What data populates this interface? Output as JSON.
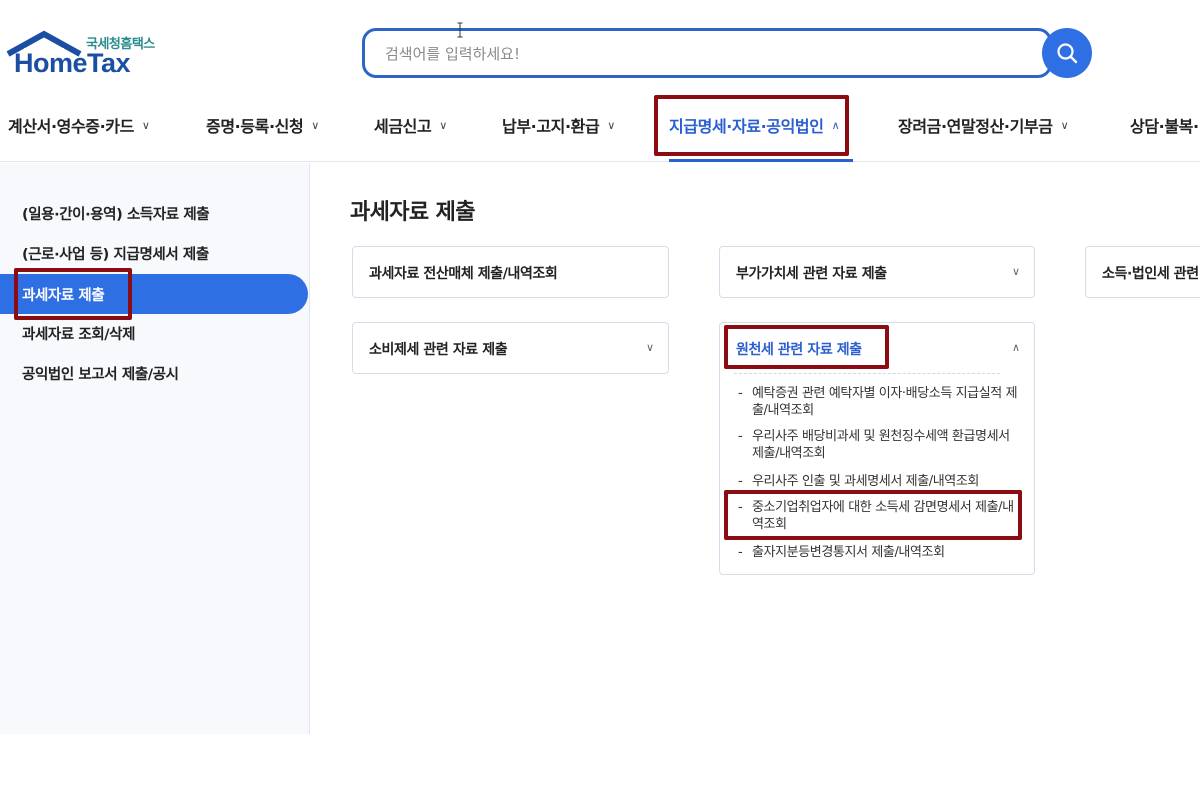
{
  "header": {
    "logo_sub": "국세청홈택스",
    "logo_main": "HomeTax",
    "search_placeholder": "검색어를 입력하세요!"
  },
  "nav": {
    "items": [
      {
        "label": "계산서·영수증·카드"
      },
      {
        "label": "증명·등록·신청"
      },
      {
        "label": "세금신고"
      },
      {
        "label": "납부·고지·환급"
      },
      {
        "label": "지급명세·자료·공익법인",
        "active": true
      },
      {
        "label": "장려금·연말정산·기부금"
      },
      {
        "label": "상담·불복·"
      }
    ]
  },
  "sidebar": {
    "items": [
      {
        "label": "(일용·간이·용역) 소득자료 제출"
      },
      {
        "label": "(근로·사업 등) 지급명세서 제출"
      },
      {
        "label": "과세자료 제출",
        "active": true
      },
      {
        "label": "과세자료 조회/삭제"
      },
      {
        "label": "공익법인 보고서 제출/공시"
      }
    ]
  },
  "main": {
    "title": "과세자료 제출",
    "cards": [
      {
        "label": "과세자료 전산매체 제출/내역조회"
      },
      {
        "label": "부가가치세 관련 자료 제출"
      },
      {
        "label": "소득·법인세 관련"
      },
      {
        "label": "소비제세 관련 자료 제출"
      },
      {
        "label": "원천세 관련 자료 제출",
        "expanded": true,
        "sub_items": [
          {
            "label": "예탁증권 관련 예탁자별 이자·배당소득 지급실적 제출/내역조회"
          },
          {
            "label": "우리사주 배당비과세 및 원천징수세액 환급명세서 제출/내역조회"
          },
          {
            "label": "우리사주 인출 및 과세명세서 제출/내역조회"
          },
          {
            "label": "중소기업취업자에 대한 소득세 감면명세서 제출/내역조회"
          },
          {
            "label": "출자지분등변경통지서 제출/내역조회"
          }
        ]
      }
    ]
  },
  "colors": {
    "brand_blue": "#2f6fe4",
    "active_text": "#2a5fd0",
    "annotation_red": "#8b0c12"
  }
}
